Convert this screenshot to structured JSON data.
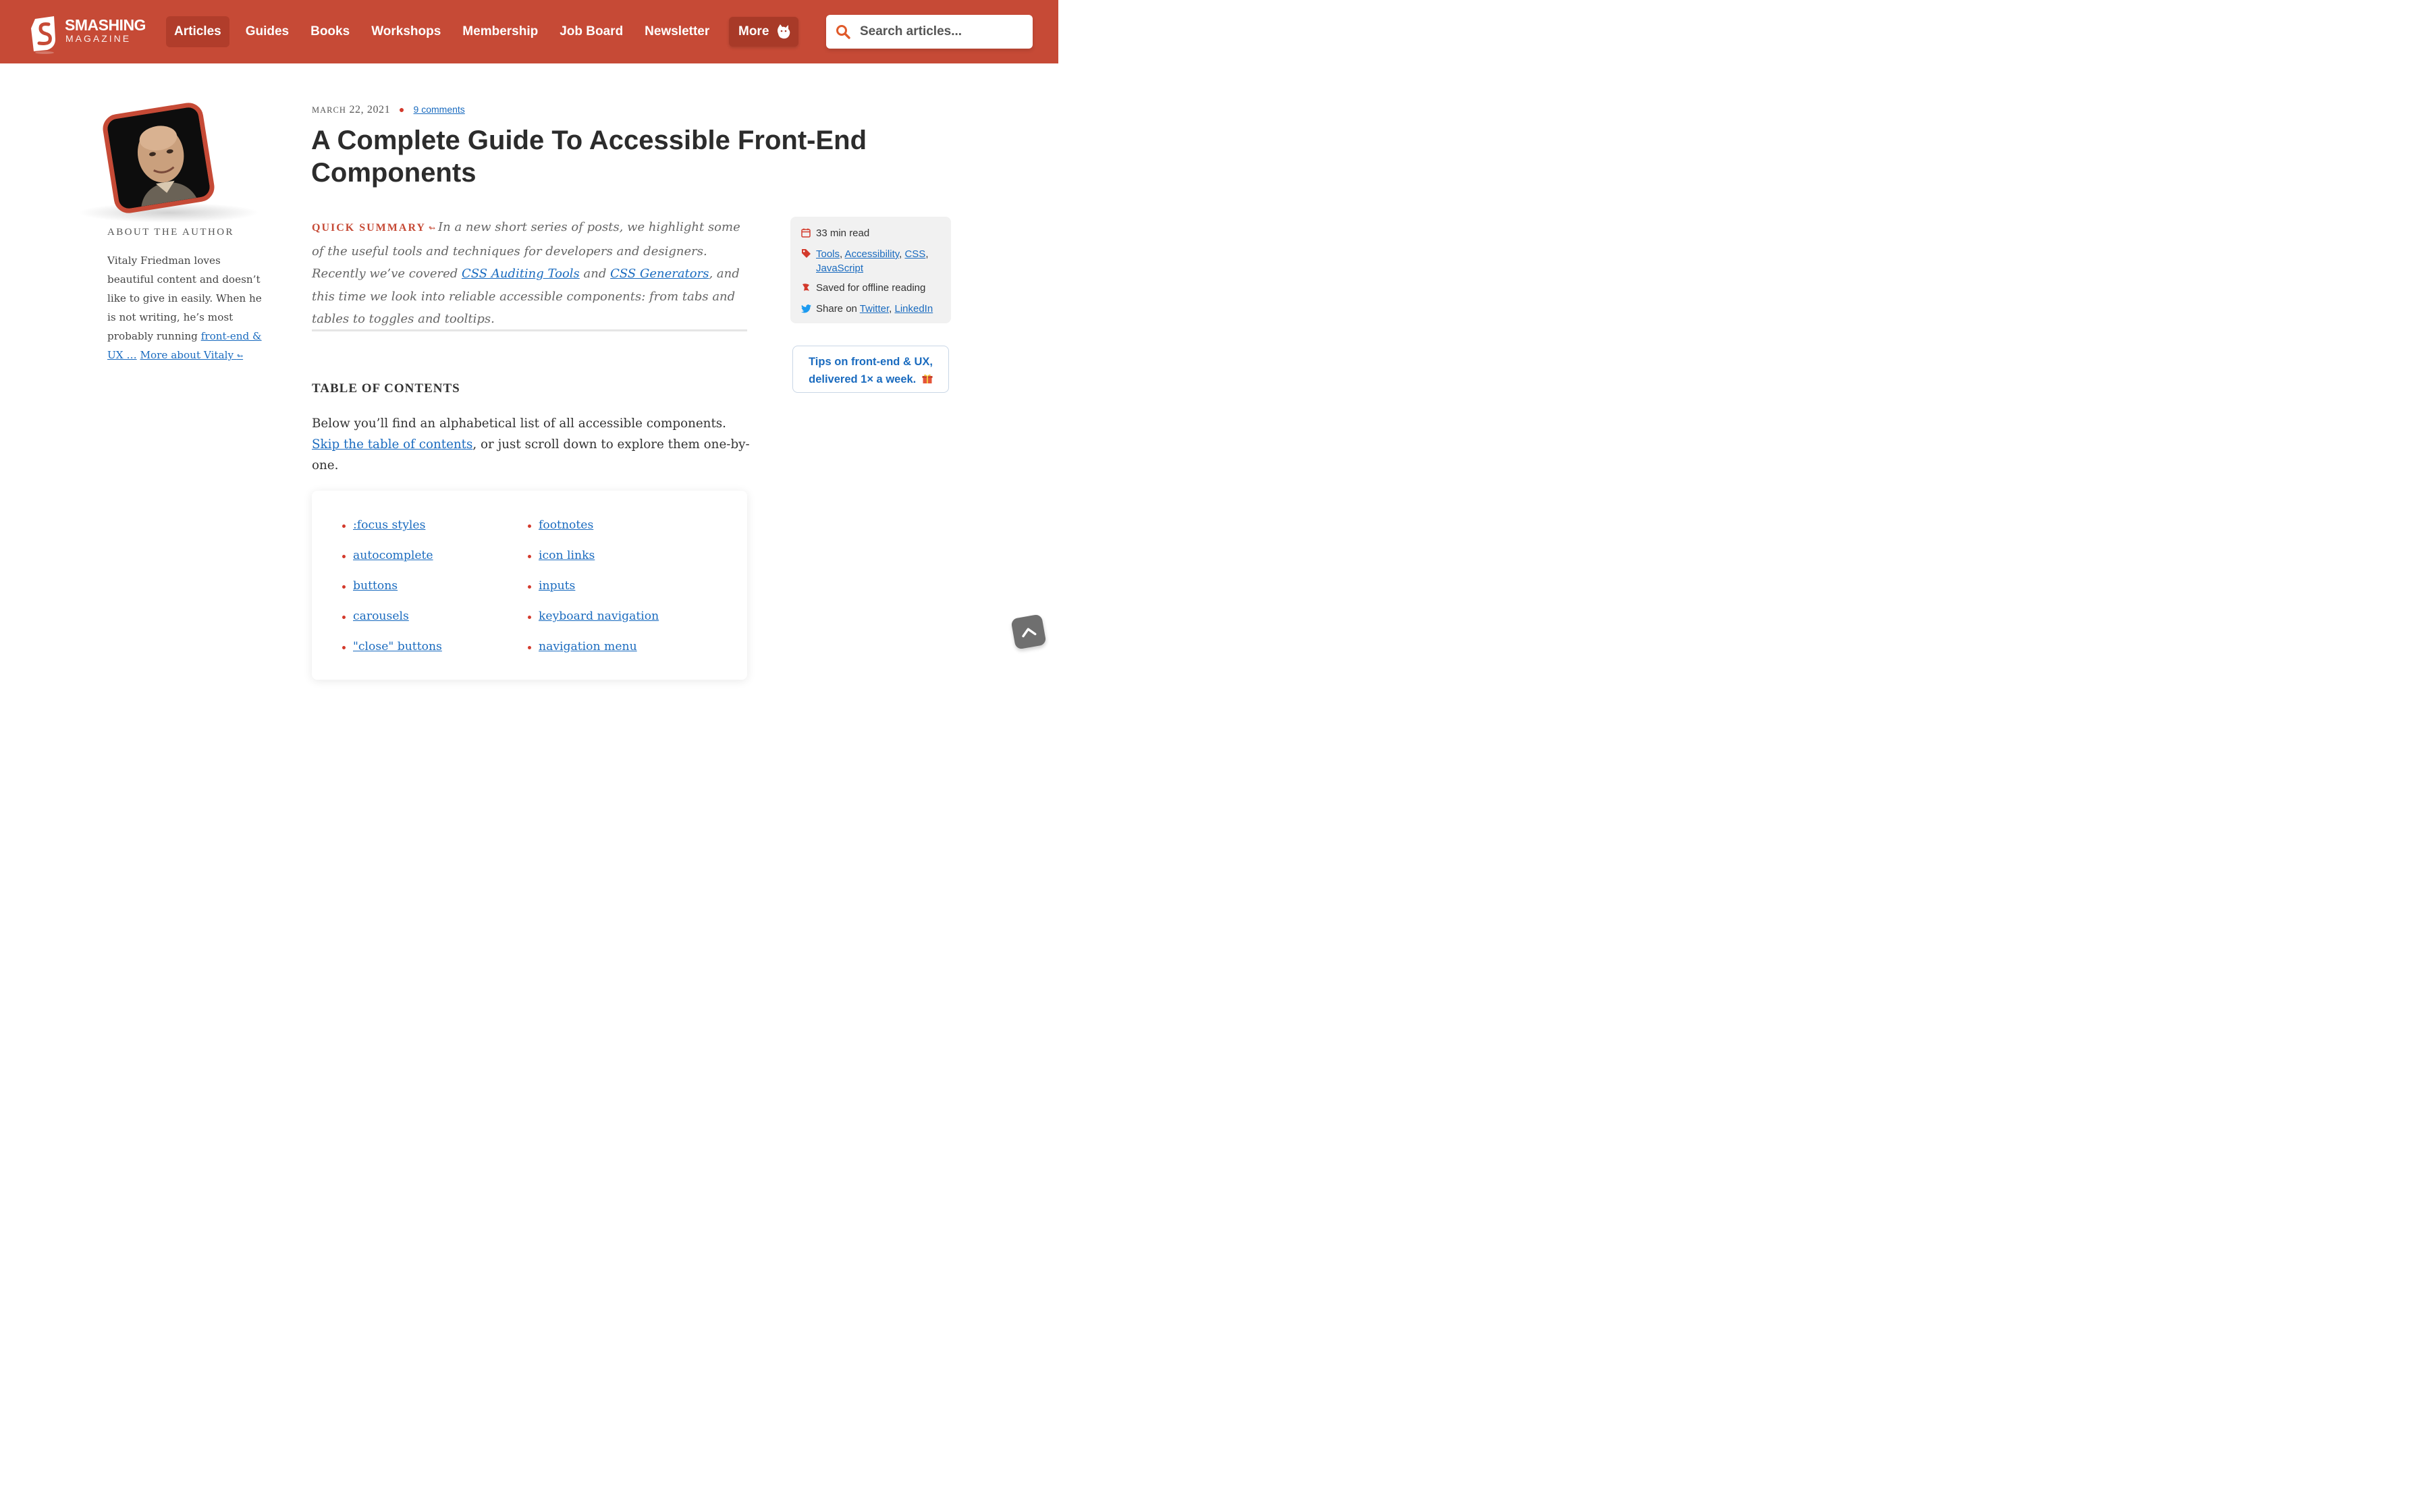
{
  "header": {
    "logo_word": "SMASHING",
    "logo_sub": "MAGAZINE",
    "nav": [
      "Articles",
      "Guides",
      "Books",
      "Workshops",
      "Membership",
      "Job Board",
      "Newsletter"
    ],
    "active_nav": "Articles",
    "more_label": "More",
    "search_placeholder": "Search articles..."
  },
  "author": {
    "about_label": "ABOUT THE AUTHOR",
    "bio_text": "Vitaly Friedman loves beautiful content and doesn’t like to give in easily. When he is not writing, he’s most probably running ",
    "bio_link": "front-end & UX …",
    "more_link": "More about Vitaly",
    "more_arrow": "↬"
  },
  "article": {
    "date_month": "MARCH",
    "date_rest": "22, 2021",
    "comments": "9 comments",
    "title": "A Complete Guide To Accessible Front-End Components",
    "summary_label": "QUICK SUMMARY",
    "summary_arrow": "↬",
    "summary_p1": "In a new short series of posts, we highlight some of the useful tools and techniques for developers and designers. Recently we’ve covered ",
    "summary_link1": "CSS Auditing Tools",
    "summary_and": " and ",
    "summary_link2": "CSS Generators",
    "summary_p2": ", and this time we look into reliable accessible components: from tabs and tables to toggles and tooltips.",
    "toc_heading": "TABLE OF CONTENTS",
    "toc_intro": "Below you’ll find an alphabetical list of all accessible components. ",
    "toc_skip_link": "Skip the table of contents",
    "toc_intro_end": ", or just scroll down to explore them one-by-one.",
    "toc_left": [
      ":focus styles",
      "autocomplete",
      "buttons",
      "carousels",
      "\"close\" buttons"
    ],
    "toc_right": [
      "footnotes",
      "icon links",
      "inputs",
      "keyboard navigation",
      "navigation menu"
    ]
  },
  "sidebar": {
    "read_time": "33 min read",
    "tags": [
      "Tools",
      "Accessibility",
      "CSS",
      "JavaScript"
    ],
    "saved": "Saved for offline reading",
    "share_prefix": "Share on ",
    "share_links": [
      "Twitter",
      "LinkedIn"
    ],
    "newsletter_line1": "Tips on front-end & UX,",
    "newsletter_line2": "delivered 1× a week."
  },
  "colors": {
    "brand": "#c64a36",
    "link": "#1a6bbf"
  },
  "icons": {
    "search": "search-icon",
    "more": "cat-icon",
    "calendar": "calendar-icon",
    "tag": "tag-icon",
    "bookmark": "bookmark-icon",
    "twitter": "twitter-icon",
    "gift": "gift-icon",
    "to_top": "chevron-up-icon"
  }
}
